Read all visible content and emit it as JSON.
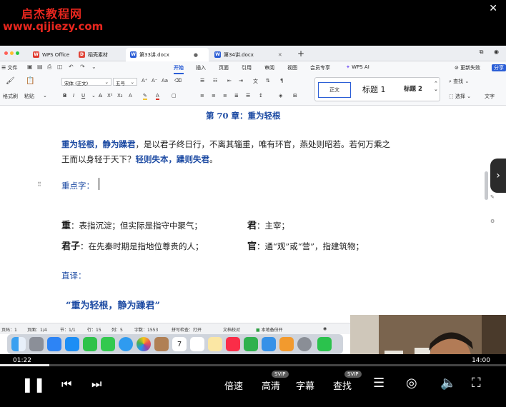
{
  "watermark": {
    "line1": "启杰教程网",
    "line2": "www.qijiezy.com"
  },
  "browser": {
    "tabs": [
      {
        "label": "WPS Office",
        "icon": "wps-logo-icon"
      },
      {
        "label": "稻壳素材",
        "icon": "docer-icon"
      },
      {
        "label": "第33讲.docx",
        "icon": "word-doc-icon"
      },
      {
        "label": "第34讲.docx",
        "icon": "word-doc-icon"
      }
    ]
  },
  "menubar": {
    "file": "文件",
    "items": [
      "开始",
      "插入",
      "页面",
      "引用",
      "审阅",
      "视图",
      "会员专享"
    ],
    "ai": "WPS AI",
    "right": [
      "更新失败",
      "分享"
    ],
    "active": "开始"
  },
  "ribbon": {
    "painter": "格式刷",
    "paste": "粘贴",
    "font_name": "宋体 (正文)",
    "font_size": "五号",
    "styles": [
      "正文",
      "标题 1",
      "标题 2"
    ],
    "find": "查找",
    "select": "选择",
    "text_tool": "文字"
  },
  "document": {
    "heading": "第 70 章：重为轻根",
    "para_line1_bold": "重为轻根，静为躁君",
    "para_line1_rest": "，是以君子终日行，不离其辎重，唯有环官，燕处则昭若。若何万乘之",
    "para_line2_rest": "王而以身轻于天下？",
    "para_line2_bold": "轻则失本，躁则失君",
    "para_line2_end": "。",
    "keyword_label": "重点字：",
    "defs": [
      {
        "term": "重",
        "def": "：表指沉淀；但实际是指守中聚气；"
      },
      {
        "term": "君",
        "def": "：主宰；"
      },
      {
        "term": "君子",
        "def": "：在先秦时期是指地位尊贵的人；"
      },
      {
        "term": "官",
        "def": "：通“观”或“营”，指建筑物；"
      }
    ],
    "translation_label": "直译：",
    "quote": "“重为轻根，静为躁君”"
  },
  "statusbar": {
    "items": [
      "页码：1",
      "页面：1/4",
      "节：1/1",
      "行：15",
      "列：5",
      "字数：1553",
      "拼写检查：打开",
      "文档校对",
      "本地备份开"
    ]
  },
  "dock": {
    "apps": [
      "finder-icon",
      "launchpad-icon",
      "mail-icon",
      "app-store-icon",
      "facetime-icon",
      "messages-icon",
      "safari-icon",
      "photos-icon",
      "contacts-icon",
      "calendar-icon",
      "reminders-icon",
      "notes-icon",
      "music-icon",
      "numbers-icon",
      "keynote-icon",
      "pages-icon",
      "settings-icon",
      "wechat-icon"
    ],
    "calendar_day": "7"
  },
  "player": {
    "current_time": "01:22",
    "total_time": "14:00",
    "progress": 0.098,
    "buttons": [
      "倍速",
      "高清",
      "字幕",
      "查找"
    ],
    "badge": "SVIP"
  },
  "colors": {
    "accent": "#2b5ed6",
    "doc_blue": "#1d4ba3",
    "watermark_red": "#e8261e"
  }
}
